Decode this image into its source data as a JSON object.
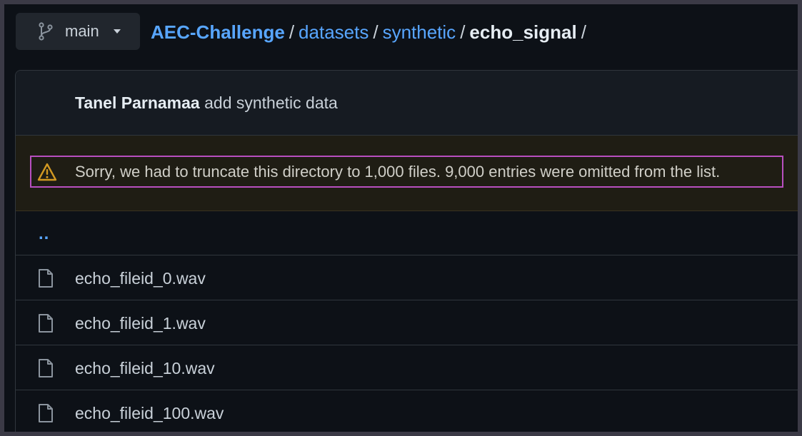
{
  "branch": {
    "icon": "git-branch-icon",
    "name": "main",
    "caret_icon": "caret-down-icon"
  },
  "breadcrumb": {
    "repo": "AEC-Challenge",
    "separator": "/",
    "crumbs": [
      "datasets",
      "synthetic"
    ],
    "current": "echo_signal"
  },
  "commit": {
    "author": "Tanel Parnamaa",
    "message": "add synthetic data"
  },
  "flash": {
    "icon": "alert-icon",
    "message": "Sorry, we had to truncate this directory to 1,000 files. 9,000 entries were omitted from the list."
  },
  "parent_link": "..",
  "files": [
    {
      "icon": "file-icon",
      "name": "echo_fileid_0.wav"
    },
    {
      "icon": "file-icon",
      "name": "echo_fileid_1.wav"
    },
    {
      "icon": "file-icon",
      "name": "echo_fileid_10.wav"
    },
    {
      "icon": "file-icon",
      "name": "echo_fileid_100.wav"
    }
  ],
  "colors": {
    "background": "#0d1117",
    "link": "#58a6ff",
    "text": "#c9d1d9",
    "warning": "#d29922",
    "highlight_outline": "#b84fc0"
  }
}
